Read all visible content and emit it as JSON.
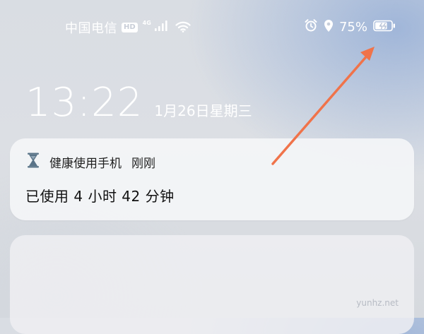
{
  "status_bar": {
    "carrier": "中国电信",
    "hd_badge": "HD",
    "network_type": "4G",
    "icons": [
      "hd-icon",
      "signal-icon",
      "wifi-icon",
      "alarm-icon",
      "location-icon",
      "battery-charging-icon"
    ],
    "battery_percent": "75%",
    "battery_level": 0.75
  },
  "lock_screen": {
    "time": "13:22",
    "date": "1月26日星期三"
  },
  "notification": {
    "app_name": "健康使用手机",
    "time": "刚刚",
    "body": "已使用 4 小时 42 分钟",
    "icon": "hourglass-icon"
  },
  "annotation": {
    "arrow_color": "#f0734a"
  },
  "watermark": "yunhz.net"
}
